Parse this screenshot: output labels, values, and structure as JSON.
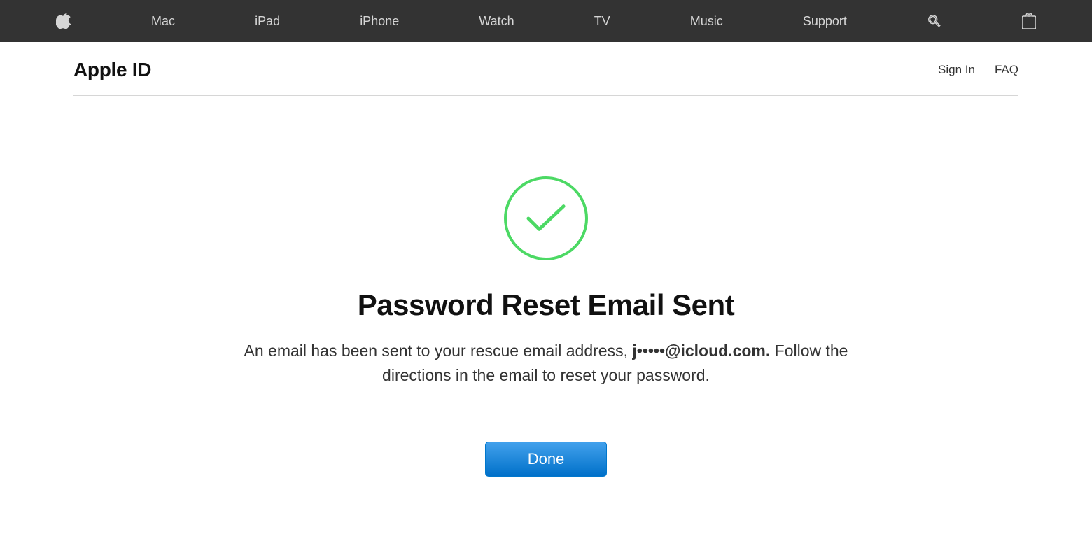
{
  "globalNav": {
    "items": [
      "Mac",
      "iPad",
      "iPhone",
      "Watch",
      "TV",
      "Music",
      "Support"
    ]
  },
  "subnav": {
    "title": "Apple ID",
    "links": [
      "Sign In",
      "FAQ"
    ]
  },
  "main": {
    "heading": "Password Reset Email Sent",
    "messagePrefix": "An email has been sent to your rescue email address, ",
    "maskedEmail": "j•••••@icloud.com.",
    "messageSuffix": " Follow the directions in the email to reset your password.",
    "doneLabel": "Done"
  },
  "colors": {
    "success": "#4cd964",
    "navBg": "#333333",
    "buttonBg": "#0070c9"
  }
}
